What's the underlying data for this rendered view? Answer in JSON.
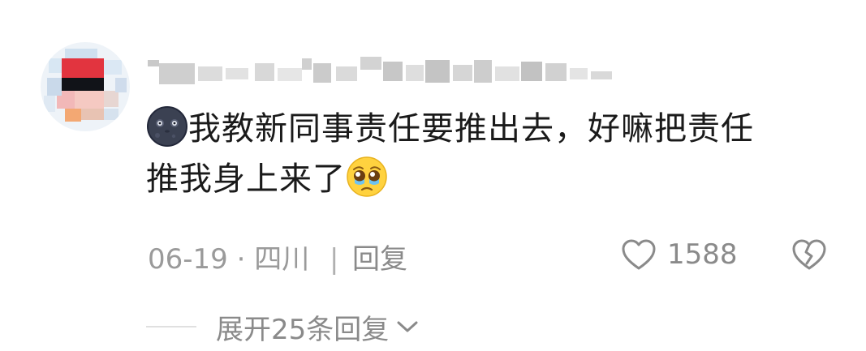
{
  "comment": {
    "avatar_icon": "avatar-mosaic",
    "username_icon": "username-mosaic",
    "text_line1": "我教新同事责任要推出去，好嘛把责任",
    "text_line2": "推我身上来了",
    "emoji_start": "dark-moon-face-emoji",
    "emoji_end": "pleading-tears-face-emoji",
    "date_location": "06-19 · 四川",
    "divider": "|",
    "reply_label": "回复",
    "like_icon": "heart-outline-icon",
    "like_count": "1588",
    "dislike_icon": "broken-heart-icon",
    "expand_label": "展开25条回复",
    "expand_icon": "chevron-down-icon"
  }
}
